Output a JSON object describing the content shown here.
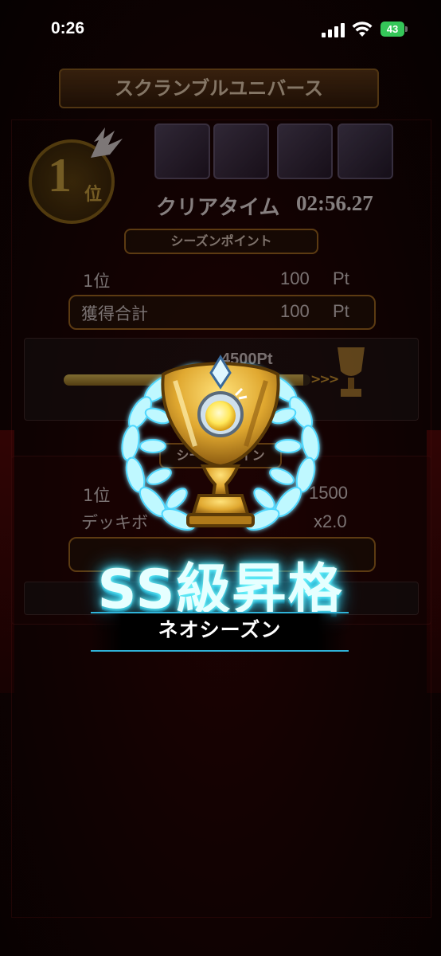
{
  "status_bar": {
    "time": "0:26",
    "battery": "43"
  },
  "quest": {
    "title": "スクランブルユニバース"
  },
  "result": {
    "rank_number": "1",
    "rank_suffix": "位",
    "clear_time_label": "クリアタイム",
    "clear_time": "02:56.27"
  },
  "season_points": {
    "header": "シーズンポイント",
    "rows": [
      {
        "label": "1位",
        "value": "100",
        "unit": "Pt"
      },
      {
        "label": "獲得合計",
        "value": "100",
        "unit": "Pt"
      }
    ]
  },
  "progress": {
    "label": "4500Pt",
    "fill_fraction": 0.97
  },
  "season_box": {
    "header": "シーズンポイン",
    "rows": [
      {
        "label": "1位",
        "value": "1500"
      },
      {
        "label": "デッキボ",
        "value": "x2.0"
      }
    ]
  },
  "promotion": {
    "title": "SS級昇格",
    "season": "ネオシーズン"
  },
  "colors": {
    "glow": "#3de0ff",
    "gold": "#e0a830",
    "banner_border": "#2fb3d9"
  },
  "icons": [
    "cellular-signal-icon",
    "wifi-icon",
    "battery-icon",
    "trophy-icon",
    "laurel-wreath-icon",
    "bomb-emblem-icon"
  ]
}
